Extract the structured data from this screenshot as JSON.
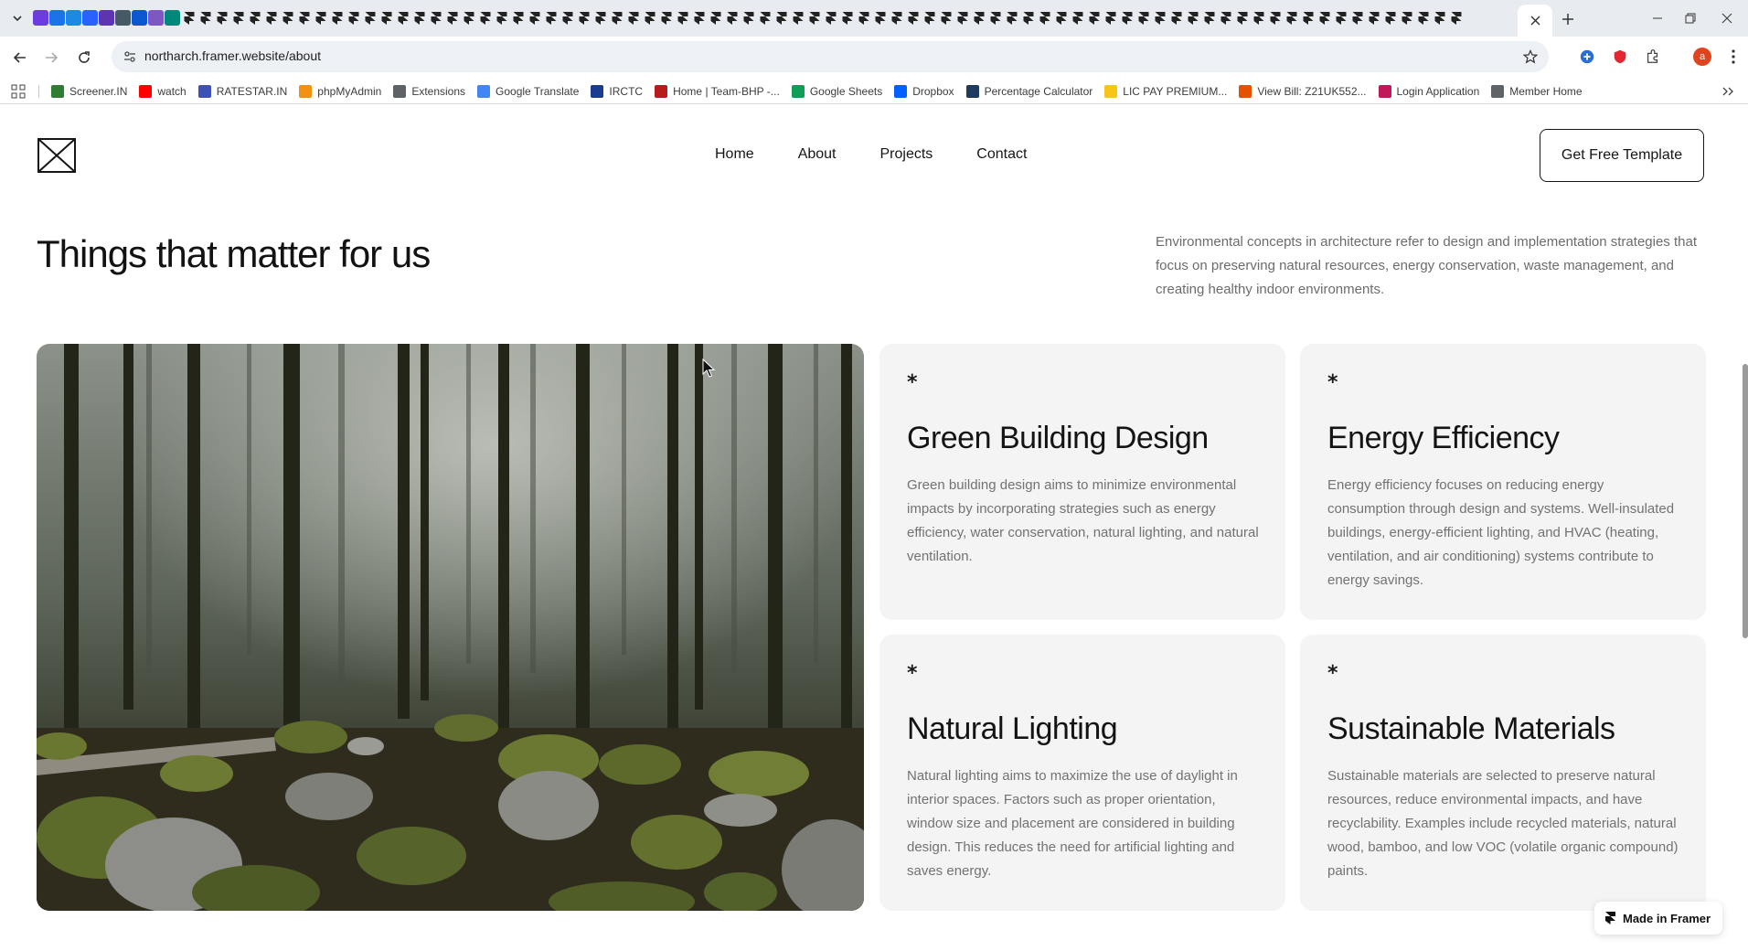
{
  "browser": {
    "url": "northarch.framer.website/about",
    "profile_initial": "a",
    "bookmarks": [
      {
        "label": "Screener.IN",
        "icon": "bar-chart-icon",
        "color": "#2e7d32"
      },
      {
        "label": "watch",
        "icon": "youtube-icon",
        "color": "#ff0000"
      },
      {
        "label": "RATESTAR.IN",
        "icon": "ratestar-icon",
        "color": "#3f51b5"
      },
      {
        "label": "phpMyAdmin",
        "icon": "phpmyadmin-icon",
        "color": "#f29111"
      },
      {
        "label": "Extensions",
        "icon": "puzzle-icon",
        "color": "#5f6368"
      },
      {
        "label": "Google Translate",
        "icon": "translate-icon",
        "color": "#4285f4"
      },
      {
        "label": "IRCTC",
        "icon": "irctc-icon",
        "color": "#1a3c8e"
      },
      {
        "label": "Home | Team-BHP -...",
        "icon": "teambhp-icon",
        "color": "#b71c1c"
      },
      {
        "label": "Google Sheets",
        "icon": "sheets-icon",
        "color": "#0f9d58"
      },
      {
        "label": "Dropbox",
        "icon": "dropbox-icon",
        "color": "#0061fe"
      },
      {
        "label": "Percentage Calculator",
        "icon": "percent-icon",
        "color": "#1e3a5f"
      },
      {
        "label": "LIC PAY PREMIUM...",
        "icon": "lic-icon",
        "color": "#f5c518"
      },
      {
        "label": "View Bill: Z21UK552...",
        "icon": "bill-icon",
        "color": "#e65100"
      },
      {
        "label": "Login Application",
        "icon": "login-icon",
        "color": "#c2185b"
      },
      {
        "label": "Member Home",
        "icon": "globe-icon",
        "color": "#5f6368"
      }
    ]
  },
  "site": {
    "nav": [
      "Home",
      "About",
      "Projects",
      "Contact"
    ],
    "cta_label": "Get Free Template",
    "heading": "Things that matter for us",
    "intro": "Environmental concepts in architecture refer to design and implementation strategies that focus on preserving natural resources, energy conservation, waste management, and creating healthy indoor environments.",
    "cards": [
      {
        "star": "*",
        "title": "Green Building Design",
        "text": "Green building design aims to minimize environmental impacts by incorporating strategies such as energy efficiency, water conservation, natural lighting, and natural ventilation."
      },
      {
        "star": "*",
        "title": "Energy Efficiency",
        "text": "Energy efficiency focuses on reducing energy consumption through design and systems. Well-insulated buildings, energy-efficient lighting, and HVAC (heating, ventilation, and air conditioning) systems contribute to energy savings."
      },
      {
        "star": "*",
        "title": "Natural Lighting",
        "text": "Natural lighting aims to maximize the use of daylight in interior spaces. Factors such as proper orientation, window size and placement are considered in building design. This reduces the need for artificial lighting and saves energy."
      },
      {
        "star": "*",
        "title": "Sustainable Materials",
        "text": "Sustainable materials are selected to preserve natural resources, reduce environmental impacts, and have recyclability. Examples include recycled materials, natural wood, bamboo, and low VOC (volatile organic compound) paints."
      }
    ],
    "badge": "Made in Framer"
  }
}
